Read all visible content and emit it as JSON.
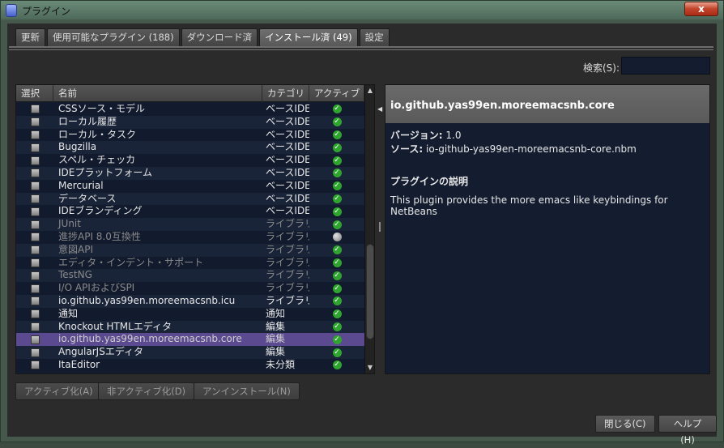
{
  "window": {
    "title": "プラグイン",
    "close_label": "x"
  },
  "tabs": [
    {
      "label": "更新",
      "active": false
    },
    {
      "label": "使用可能なプラグイン (188)",
      "active": false
    },
    {
      "label": "ダウンロード済",
      "active": false
    },
    {
      "label": "インストール済 (49)",
      "active": true
    },
    {
      "label": "設定",
      "active": false
    }
  ],
  "search": {
    "label": "検索(S):",
    "value": ""
  },
  "table": {
    "columns": [
      "選択",
      "名前",
      "カテゴリ",
      "アクティブ"
    ],
    "rows": [
      {
        "name": "CSSソース・モデル",
        "category": "ベースIDE",
        "active": true,
        "dim": false
      },
      {
        "name": "ローカル履歴",
        "category": "ベースIDE",
        "active": true,
        "dim": false
      },
      {
        "name": "ローカル・タスク",
        "category": "ベースIDE",
        "active": true,
        "dim": false
      },
      {
        "name": "Bugzilla",
        "category": "ベースIDE",
        "active": true,
        "dim": false
      },
      {
        "name": "スペル・チェッカ",
        "category": "ベースIDE",
        "active": true,
        "dim": false
      },
      {
        "name": "IDEプラットフォーム",
        "category": "ベースIDE",
        "active": true,
        "dim": false
      },
      {
        "name": "Mercurial",
        "category": "ベースIDE",
        "active": true,
        "dim": false
      },
      {
        "name": "データベース",
        "category": "ベースIDE",
        "active": true,
        "dim": false
      },
      {
        "name": "IDEブランディング",
        "category": "ベースIDE",
        "active": true,
        "dim": false
      },
      {
        "name": "JUnit",
        "category": "ライブラリ",
        "active": true,
        "dim": true
      },
      {
        "name": "進捗API 8.0互換性",
        "category": "ライブラリ",
        "active": false,
        "dim": true
      },
      {
        "name": "意図API",
        "category": "ライブラリ",
        "active": true,
        "dim": true
      },
      {
        "name": "エディタ・インデント・サポート",
        "category": "ライブラリ",
        "active": true,
        "dim": true
      },
      {
        "name": "TestNG",
        "category": "ライブラリ",
        "active": true,
        "dim": true
      },
      {
        "name": "I/O APIおよびSPI",
        "category": "ライブラリ",
        "active": true,
        "dim": true
      },
      {
        "name": "io.github.yas99en.moreemacsnb.icu",
        "category": "ライブラリ",
        "active": true,
        "dim": false
      },
      {
        "name": "通知",
        "category": "通知",
        "active": true,
        "dim": false
      },
      {
        "name": "Knockout HTMLエディタ",
        "category": "編集",
        "active": true,
        "dim": false
      },
      {
        "name": "io.github.yas99en.moreemacsnb.core",
        "category": "編集",
        "active": true,
        "dim": false,
        "selected": true
      },
      {
        "name": "AngularJSエディタ",
        "category": "編集",
        "active": true,
        "dim": false
      },
      {
        "name": "ItaEditor",
        "category": "未分類",
        "active": true,
        "dim": false
      }
    ]
  },
  "detail": {
    "title": "io.github.yas99en.moreemacsnb.core",
    "version_label": "バージョン:",
    "version_value": "1.0",
    "source_label": "ソース:",
    "source_value": "io-github-yas99en-moreemacsnb-core.nbm",
    "desc_title": "プラグインの説明",
    "desc_text": "This plugin provides the more emacs like keybindings for NetBeans"
  },
  "buttons": {
    "activate": "アクティブ化(A)",
    "deactivate": "非アクティブ化(D)",
    "uninstall": "アンインストール(N)",
    "close": "閉じる(C)",
    "help": "ヘルプ(H)"
  }
}
